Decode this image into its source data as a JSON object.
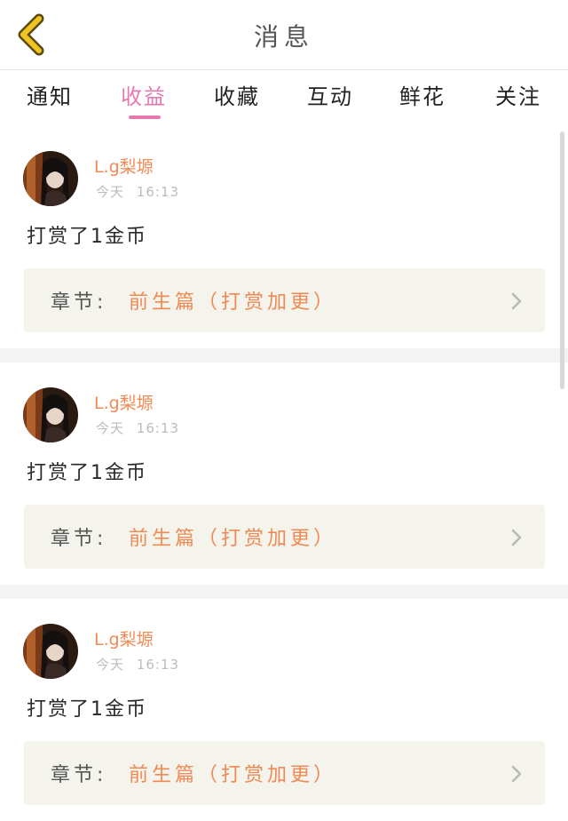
{
  "header": {
    "title": "消息",
    "back_icon": "chevron-left-icon",
    "back_icon_color": "#e8bb1c"
  },
  "tabs": [
    {
      "label": "通知",
      "active": false
    },
    {
      "label": "收益",
      "active": true
    },
    {
      "label": "收藏",
      "active": false
    },
    {
      "label": "互动",
      "active": false
    },
    {
      "label": "鲜花",
      "active": false
    },
    {
      "label": "关注",
      "active": false
    }
  ],
  "colors": {
    "accent_pink": "#e679b0",
    "accent_orange": "#f08a54",
    "chapter_bg": "#f4f3ec"
  },
  "messages": [
    {
      "user": "L.g梨塬",
      "time_day": "今天",
      "time_clock": "16:13",
      "text": "打赏了1金币",
      "chapter_label": "章节:",
      "chapter_title": "前生篇（打赏加更）"
    },
    {
      "user": "L.g梨塬",
      "time_day": "今天",
      "time_clock": "16:13",
      "text": "打赏了1金币",
      "chapter_label": "章节:",
      "chapter_title": "前生篇（打赏加更）"
    },
    {
      "user": "L.g梨塬",
      "time_day": "今天",
      "time_clock": "16:13",
      "text": "打赏了1金币",
      "chapter_label": "章节:",
      "chapter_title": "前生篇（打赏加更）"
    }
  ]
}
